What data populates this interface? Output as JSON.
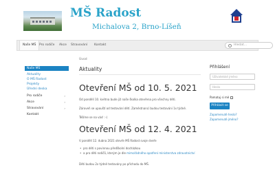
{
  "header": {
    "title": "MŠ Radost",
    "address": "Michalova 2, Brno-Líšeň"
  },
  "nav": {
    "items": [
      "Naše MŠ",
      "Pro rodiče",
      "Akce",
      "Stravování",
      "Kontakt"
    ],
    "active": "Naše MŠ",
    "search_placeholder": "Hledat..."
  },
  "sidebar": {
    "items": [
      {
        "label": "Naše MŠ",
        "active": true
      },
      {
        "label": "Aktuality",
        "sub": true
      },
      {
        "label": "O MŠ Radost",
        "sub": true
      },
      {
        "label": "Projekty",
        "sub": true
      },
      {
        "label": "Úřední deska",
        "sub": true
      },
      {
        "label": "Pro rodiče",
        "chevron": "›"
      },
      {
        "label": "Akce",
        "chevron": "›"
      },
      {
        "label": "Stravování",
        "chevron": "›"
      },
      {
        "label": "Kontakt"
      }
    ]
  },
  "main": {
    "breadcrumb": "Úvod",
    "page_title": "Aktuality",
    "article1": {
      "heading": "Otevření MŠ od 10. 5. 2021",
      "p1": "Od pondělí 10. května bude již naše školka otevřena pro všechny děti.",
      "p2": "Zároveň se upouští od testování dětí. Zaměstnanci budou testováni 1x týdně.",
      "p3": "Těšíme se na vás! :-)"
    },
    "article2": {
      "heading": "Otevření MŠ od 12. 4. 2021",
      "p1": "V pondělí 12. dubna 2021 otevře MŠ Radost svoje dveře",
      "li1": "pro děti s povinnou předškolní docházkou",
      "li2_text": "a pro děti rodičů, kterým je dle ",
      "li2_link": "mimořádného opatření ministerstva zdravotnictví",
      "p2": "Děti budou 2x týdně testovány po příchodu do MŠ."
    }
  },
  "login": {
    "title": "Přihlášení",
    "username_placeholder": "Uživatelské jméno",
    "password_placeholder": "Heslo",
    "remember_label": "Pamatuj si mě",
    "submit_label": "Přihlásit se",
    "forgot_password": "Zapomenuté heslo?",
    "forgot_username": "Zapomenuté jméno?"
  }
}
